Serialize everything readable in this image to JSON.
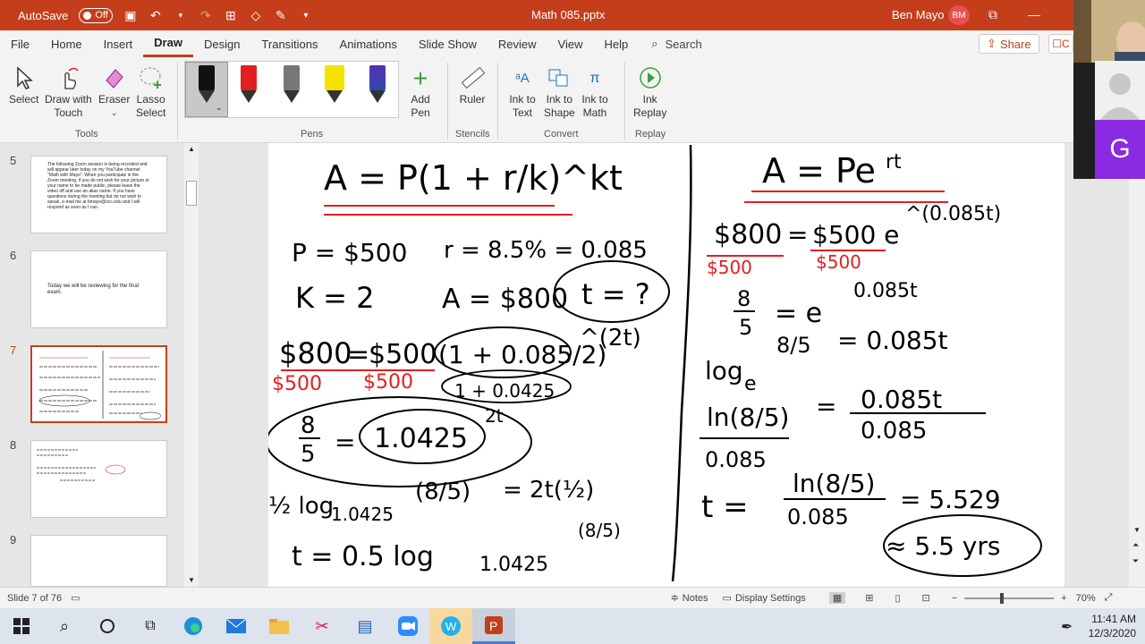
{
  "titlebar": {
    "autosave_label": "AutoSave",
    "autosave_state": "Off",
    "doc_title": "Math 085.pptx",
    "user_name": "Ben Mayo",
    "user_initials": "BM"
  },
  "tabs": [
    "File",
    "Home",
    "Insert",
    "Draw",
    "Design",
    "Transitions",
    "Animations",
    "Slide Show",
    "Review",
    "View",
    "Help"
  ],
  "active_tab": "Draw",
  "search_label": "Search",
  "share_label": "Share",
  "comment_label": "C",
  "ribbon": {
    "tools": {
      "select": "Select",
      "draw_touch_1": "Draw with",
      "draw_touch_2": "Touch",
      "eraser": "Eraser",
      "lasso_1": "Lasso",
      "lasso_2": "Select",
      "group": "Tools"
    },
    "pens": {
      "add_pen_1": "Add",
      "add_pen_2": "Pen",
      "group": "Pens"
    },
    "stencils": {
      "ruler": "Ruler",
      "group": "Stencils"
    },
    "convert": {
      "ink_text_1": "Ink to",
      "ink_text_2": "Text",
      "ink_shape_1": "Ink to",
      "ink_shape_2": "Shape",
      "ink_math_1": "Ink to",
      "ink_math_2": "Math",
      "group": "Convert"
    },
    "replay": {
      "ink_replay_1": "Ink",
      "ink_replay_2": "Replay",
      "group": "Replay"
    },
    "pen_colors": [
      "#111111",
      "#e02020",
      "#777777",
      "#f4e200",
      "#2a4db0"
    ]
  },
  "slides": [
    {
      "num": "5",
      "text": "The following Zoom session is being recorded and will appear later today on my YouTube channel \"Math with Mayo\". When you participate in the Zoom meeting, if you do not wish for your picture or your name to be made public, please leave the video off and use an alias name. If you have questions during the meeting but do not wish to speak, e-mail me at bmayo@occ.edu and I will respond as soon as I can."
    },
    {
      "num": "6",
      "text": "Today we will be reviewing for the final exam."
    },
    {
      "num": "7",
      "text": ""
    },
    {
      "num": "8",
      "text": ""
    },
    {
      "num": "9",
      "text": ""
    }
  ],
  "statusbar": {
    "slide_info": "Slide 7 of 76",
    "notes": "Notes",
    "display_settings": "Display Settings",
    "zoom": "70%"
  },
  "taskbar": {
    "time": "11:41 AM",
    "date": "12/3/2020"
  },
  "video": {
    "participant_initial": "G"
  },
  "slide_content": {
    "left_formula": "A = P(1 + r/k)^kt",
    "p": "P = $500",
    "r": "r = 8.5% = 0.085",
    "k": "K = 2",
    "a": "A = $800",
    "t": "t = ?",
    "s1_lhs": "$800",
    "s1_rhs": "$500",
    "s1_base": "(1 + 0.085/2)",
    "s1_exp": "^(2t)",
    "s1_simpl": "1 + 0.0425",
    "s1_lhs_div": "$500",
    "s1_rhs_div": "$500",
    "s2_frac_num": "8",
    "s2_frac_den": "5",
    "s2_base": "1.0425",
    "s2_exp": "2t",
    "s3_left": "½ log",
    "s3_sub": "1.0425",
    "s3_arg": "(8/5)",
    "s3_rhs": "= 2t(½)",
    "s3_arg2": "(8/5)",
    "s4": "t = 0.5 log",
    "s4_sub": "1.0425",
    "right_formula": "A = Pe",
    "right_exp": "rt",
    "r1_lhs": "$800",
    "r1_rhs": "$500 e",
    "r1_exp": "^(0.085t)",
    "r1_div1": "$500",
    "r1_div2": "$500",
    "r2_num": "8",
    "r2_den": "5",
    "r2_rhs": "= e",
    "r2_exp": "0.085t",
    "r3_log": "log",
    "r3_base": "e",
    "r3_arg": "8/5",
    "r3_rhs": "= 0.085t",
    "r4_ln": "ln(8/5)",
    "r4_den": "0.085",
    "r4_rhs_num": "0.085t",
    "r4_rhs_den": "0.085",
    "r5_t": "t =",
    "r5_num": "ln(8/5)",
    "r5_den": "0.085",
    "r5_val": "= 5.529",
    "r5_ans": "≈ 5.5 yrs"
  }
}
